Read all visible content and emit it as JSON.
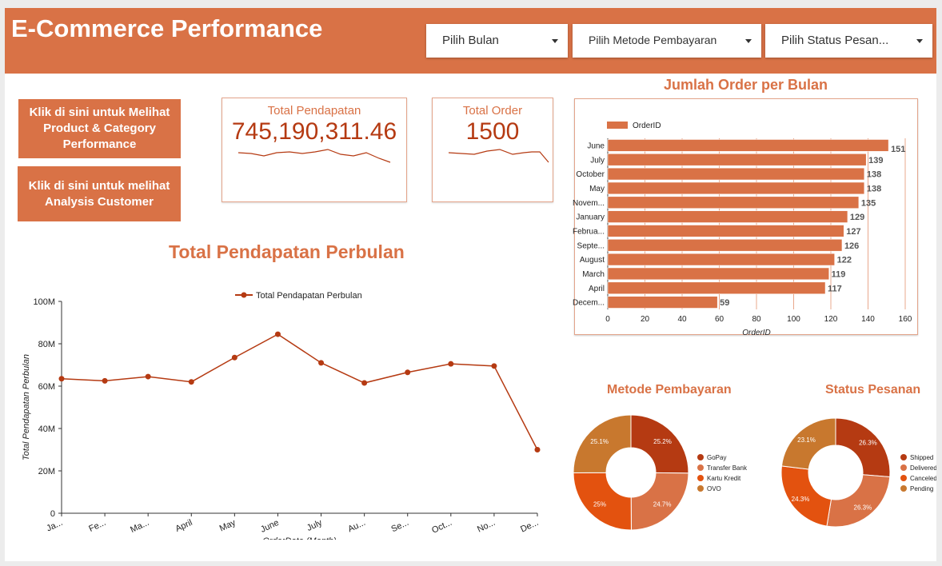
{
  "header": {
    "title": "E-Commerce Performance",
    "filters": [
      {
        "label": "Pilih Bulan"
      },
      {
        "label": "Pilih Metode Pembayaran"
      },
      {
        "label": "Pilih Status Pesan..."
      }
    ]
  },
  "nav": {
    "product_btn": "Klik di sini untuk Melihat Product & Category Performance",
    "customer_btn": "Klik di sini untuk melihat Analysis Customer"
  },
  "scorecards": {
    "revenue": {
      "label": "Total Pendapatan",
      "value": "745,190,311.46"
    },
    "orders": {
      "label": "Total Order",
      "value": "1500"
    }
  },
  "colors": {
    "accent": "#d97246",
    "dark_accent": "#b53a12",
    "bar": "#d97246",
    "line": "#b53a12",
    "pie": [
      "#b53a12",
      "#d97246",
      "#e3520f",
      "#c8782e"
    ]
  },
  "chart_data": [
    {
      "id": "revenue_line",
      "type": "line",
      "title": "Total Pendapatan Perbulan",
      "xlabel": "OrderDate (Month)",
      "ylabel": "Total Pendapatan Perbulan",
      "legend": [
        "Total Pendapatan Perbulan"
      ],
      "legend_position": "top",
      "categories": [
        "Ja...",
        "Fe...",
        "Ma...",
        "April",
        "May",
        "June",
        "July",
        "Au...",
        "Se...",
        "Oct...",
        "No...",
        "De..."
      ],
      "values": [
        63.5,
        62.5,
        64.5,
        62,
        73.5,
        84.5,
        71,
        61.5,
        66.5,
        70.5,
        69.5,
        30
      ],
      "unit": "M",
      "ylim": [
        0,
        100
      ],
      "yticks": [
        "0",
        "20M",
        "40M",
        "60M",
        "80M",
        "100M"
      ]
    },
    {
      "id": "orders_bar",
      "type": "bar",
      "orientation": "horizontal",
      "title": "Jumlah Order per Bulan",
      "xlabel": "OrderID",
      "legend": [
        "OrderID"
      ],
      "legend_position": "top-left",
      "categories": [
        "June",
        "July",
        "October",
        "May",
        "Novem...",
        "January",
        "Februa...",
        "Septe...",
        "August",
        "March",
        "April",
        "Decem..."
      ],
      "values": [
        151,
        139,
        138,
        138,
        135,
        129,
        127,
        126,
        122,
        119,
        117,
        59
      ],
      "xlim": [
        0,
        160
      ],
      "xticks": [
        "0",
        "20",
        "40",
        "60",
        "80",
        "100",
        "120",
        "140",
        "160"
      ]
    },
    {
      "id": "payment_pie",
      "type": "pie",
      "title": "Metode Pembayaran",
      "labels": [
        "GoPay",
        "Transfer Bank",
        "Kartu Kredit",
        "OVO"
      ],
      "values": [
        25.2,
        24.7,
        25,
        25.1
      ],
      "value_labels": [
        "25.2%",
        "24.7%",
        "25%",
        "25.1%"
      ]
    },
    {
      "id": "status_pie",
      "type": "pie",
      "title": "Status Pesanan",
      "labels": [
        "Shipped",
        "Delivered",
        "Canceled",
        "Pending"
      ],
      "values": [
        26.3,
        26.3,
        24.3,
        23.1
      ],
      "value_labels": [
        "26.3%",
        "26.3%",
        "24.3%",
        "23.1%"
      ]
    }
  ]
}
